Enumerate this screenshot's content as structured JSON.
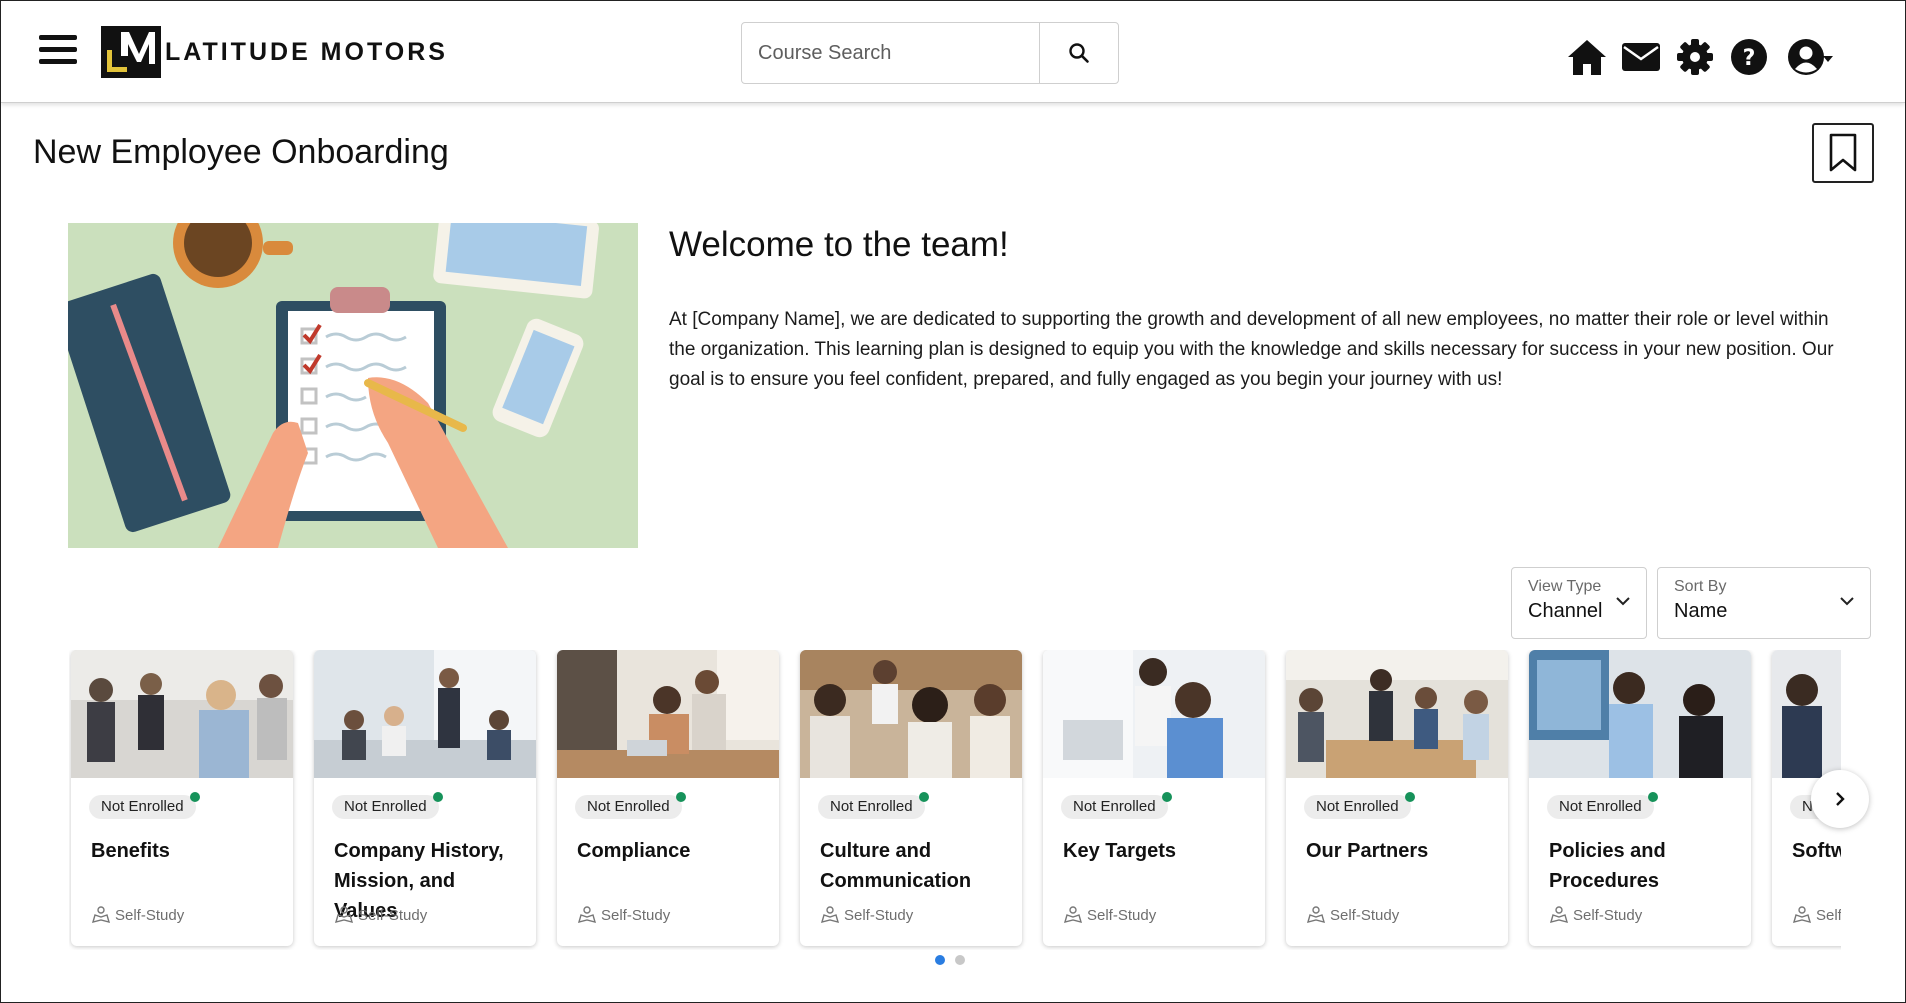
{
  "header": {
    "logo_text": "LATITUDE MOTORS",
    "search": {
      "placeholder": "Course Search"
    },
    "icons": [
      "home-icon",
      "mail-icon",
      "settings-icon",
      "help-icon",
      "user-icon"
    ]
  },
  "page": {
    "title": "New Employee Onboarding"
  },
  "hero": {
    "title": "Welcome to the team!",
    "body": "At [Company Name], we are dedicated to supporting the growth and development of all new employees, no matter their role or level within the organization. This learning plan is designed to equip you with the knowledge and skills necessary for success in your new position. Our goal is to ensure you feel confident, prepared, and fully engaged as you begin your journey with us!"
  },
  "filters": {
    "view_type": {
      "label": "View Type",
      "value": "Channel"
    },
    "sort_by": {
      "label": "Sort By",
      "value": "Name"
    }
  },
  "cards": [
    {
      "status": "Not Enrolled",
      "title": "Benefits",
      "type": "Self-Study"
    },
    {
      "status": "Not Enrolled",
      "title": "Company History, Mission, and Values",
      "type": "Self-Study"
    },
    {
      "status": "Not Enrolled",
      "title": "Compliance",
      "type": "Self-Study"
    },
    {
      "status": "Not Enrolled",
      "title": "Culture and Communication",
      "type": "Self-Study"
    },
    {
      "status": "Not Enrolled",
      "title": "Key Targets",
      "type": "Self-Study"
    },
    {
      "status": "Not Enrolled",
      "title": "Our Partners",
      "type": "Self-Study"
    },
    {
      "status": "Not Enrolled",
      "title": "Policies and Procedures",
      "type": "Self-Study"
    },
    {
      "status": "Not Enrolled",
      "title": "Software Systems",
      "type": "Self-Study"
    }
  ],
  "pagination": {
    "pages": 2,
    "current": 1
  },
  "colors": {
    "status_dot": "#16925a",
    "active_dot": "#2a7de1",
    "hero_bg": "#cbe0bd",
    "logo_accent": "#e2c33a"
  }
}
